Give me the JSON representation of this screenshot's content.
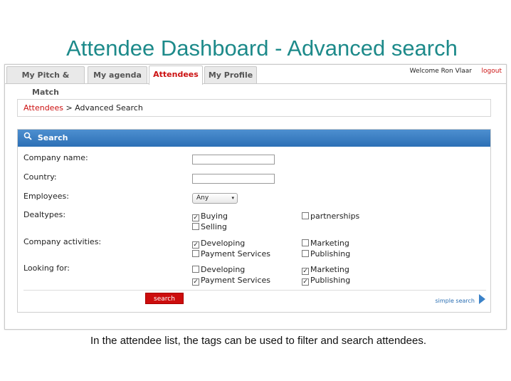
{
  "slide": {
    "title": "Attendee Dashboard - Advanced search",
    "caption": "In the attendee list, the tags can be used to filter and search attendees."
  },
  "header": {
    "tabs": [
      "My Pitch & Match",
      "My agenda",
      "Attendees",
      "My Profile"
    ],
    "active_tab": "Attendees",
    "welcome": "Welcome Ron Vlaar",
    "logout": "logout"
  },
  "breadcrumb": {
    "link": "Attendees",
    "separator": ">",
    "current": "Advanced Search"
  },
  "search": {
    "heading": "Search",
    "company_name_label": "Company name:",
    "company_name_value": "",
    "country_label": "Country:",
    "country_value": "",
    "employees_label": "Employees:",
    "employees_value": "Any",
    "dealtypes_label": "Dealtypes:",
    "dealtypes": [
      {
        "label": "Buying",
        "checked": true
      },
      {
        "label": "partnerships",
        "checked": false
      },
      {
        "label": "Selling",
        "checked": false
      }
    ],
    "activities_label": "Company activities:",
    "activities": [
      {
        "label": "Developing",
        "checked": true
      },
      {
        "label": "Marketing",
        "checked": false
      },
      {
        "label": "Payment Services",
        "checked": false
      },
      {
        "label": "Publishing",
        "checked": false
      }
    ],
    "looking_label": "Looking for:",
    "looking": [
      {
        "label": "Developing",
        "checked": false
      },
      {
        "label": "Marketing",
        "checked": true
      },
      {
        "label": "Payment Services",
        "checked": true
      },
      {
        "label": "Publishing",
        "checked": true
      }
    ],
    "search_button": "search",
    "simple_search_link": "simple search"
  },
  "colors": {
    "title": "#1d8a8a",
    "accent_red": "#cc1111",
    "header_blue": "#2c6fb5"
  }
}
